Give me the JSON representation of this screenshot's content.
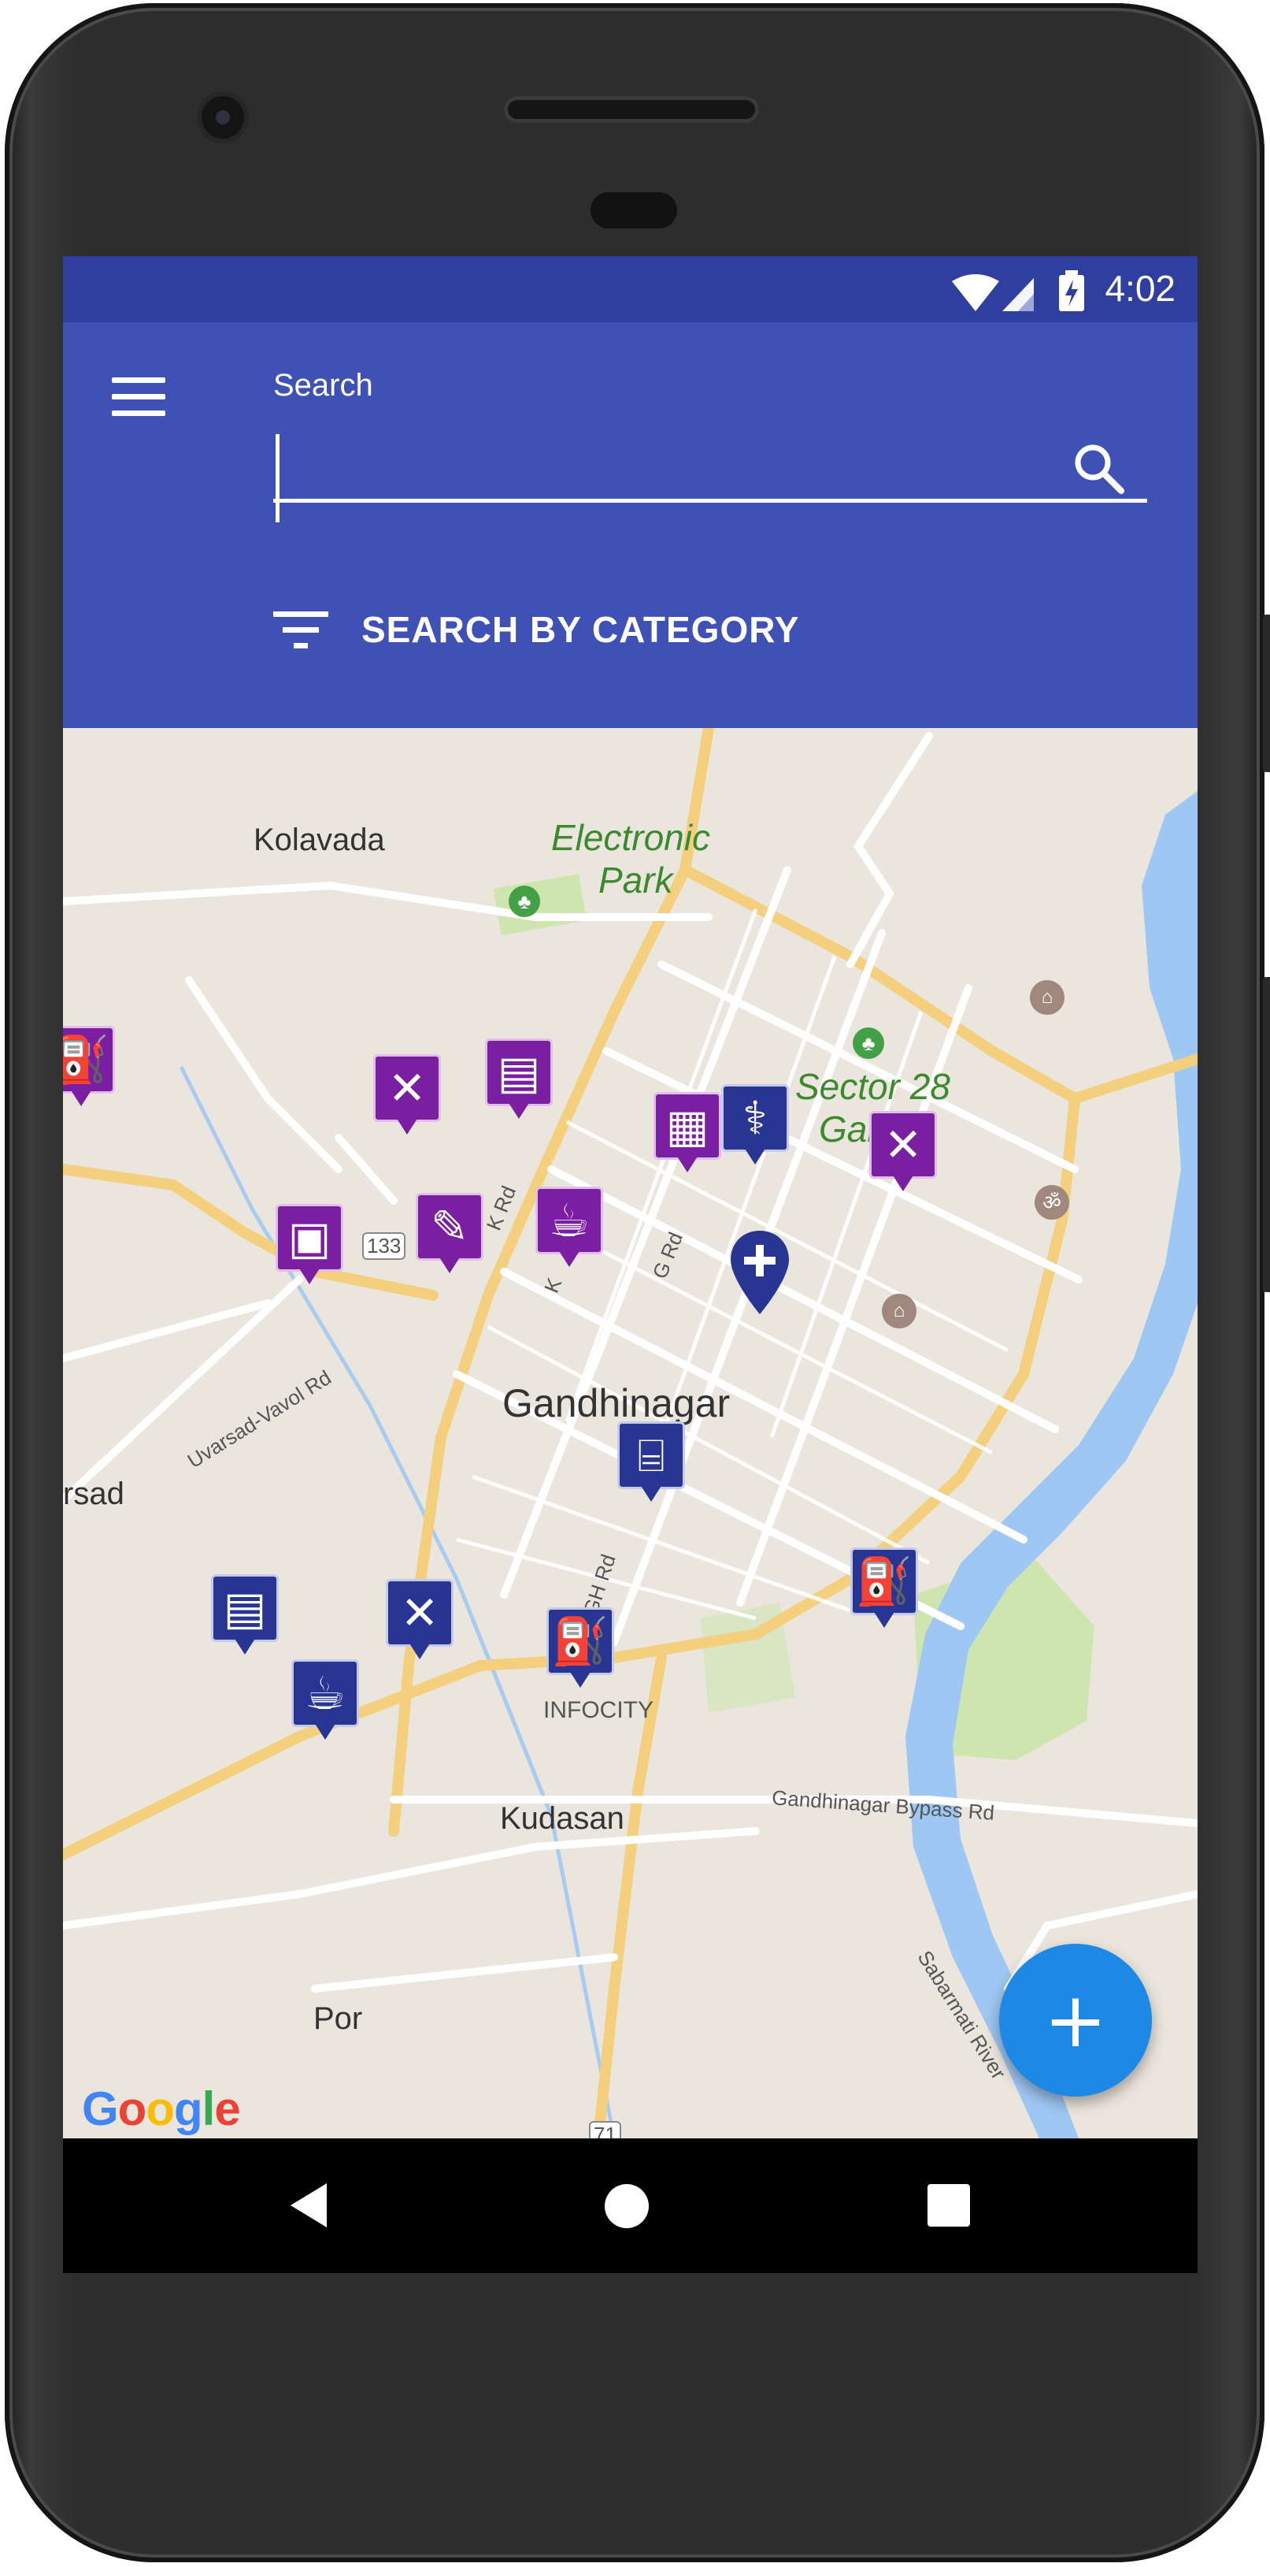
{
  "status_bar": {
    "time": "4:02",
    "icons": [
      "wifi-icon",
      "cell-signal-icon",
      "battery-charging-icon"
    ]
  },
  "app_bar": {
    "search_label": "Search",
    "search_value": "",
    "category_button_label": "SEARCH BY CATEGORY"
  },
  "map": {
    "places": {
      "kolavada": "Kolavada",
      "electronic_park_1": "Electronic",
      "electronic_park_2": "Park",
      "sector28_1": "Sector 28",
      "sector28_2": "Gar",
      "gandhinagar": "Gandhinagar",
      "rsad": "rsad",
      "infocity": "INFOCITY",
      "kudasan": "Kudasan",
      "por": "Por"
    },
    "roads": {
      "uvarsad": "Uvarsad-Vavol Rd",
      "k_rd": "K Rd",
      "g_rd": "G Rd",
      "k2": "K",
      "gh_rd": "GH Rd",
      "bypass": "Gandhinagar Bypass Rd",
      "river": "Sabarmati River",
      "route_133": "133",
      "route_71": "71"
    },
    "markers": [
      {
        "name": "fuel-marker",
        "category": "fuel",
        "theme": "purple"
      },
      {
        "name": "restaurant-marker",
        "category": "restaurant",
        "theme": "purple"
      },
      {
        "name": "cinema-marker",
        "category": "cinema",
        "theme": "purple"
      },
      {
        "name": "atm-marker",
        "category": "atm",
        "theme": "purple"
      },
      {
        "name": "hospital-marker",
        "category": "hospital",
        "theme": "blue"
      },
      {
        "name": "restaurant-marker",
        "category": "restaurant",
        "theme": "purple"
      },
      {
        "name": "shopping-marker",
        "category": "shopping",
        "theme": "purple"
      },
      {
        "name": "stationery-marker",
        "category": "stationery",
        "theme": "purple"
      },
      {
        "name": "cafe-marker",
        "category": "cafe",
        "theme": "purple"
      },
      {
        "name": "hotel-marker",
        "category": "hotel",
        "theme": "blue"
      },
      {
        "name": "fuel-marker",
        "category": "fuel",
        "theme": "blue"
      },
      {
        "name": "cinema-marker",
        "category": "cinema",
        "theme": "blue"
      },
      {
        "name": "restaurant-marker",
        "category": "restaurant",
        "theme": "blue"
      },
      {
        "name": "fuel-marker",
        "category": "fuel",
        "theme": "blue"
      },
      {
        "name": "cafe-marker",
        "category": "cafe",
        "theme": "blue"
      }
    ],
    "attribution": "Google"
  },
  "colors": {
    "status_bar": "#303f9f",
    "app_bar": "#3f51b5",
    "fab": "#1e88e5",
    "marker_purple": "#7b1fa2",
    "marker_blue": "#283593"
  },
  "fab": {
    "icon": "add-icon",
    "glyph": "+"
  },
  "nav_bar": {
    "icons": [
      "back-icon",
      "home-icon",
      "recents-icon"
    ]
  }
}
